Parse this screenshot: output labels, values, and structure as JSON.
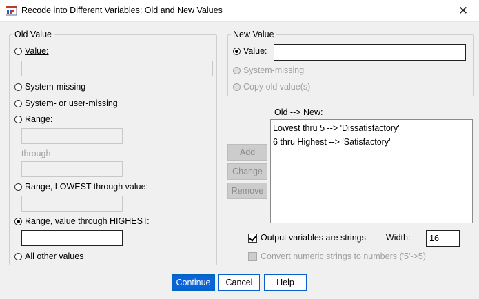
{
  "window": {
    "title": "Recode into Different Variables: Old and New Values",
    "close_glyph": "✕"
  },
  "old_value": {
    "legend": "Old Value",
    "value_label": "Value:",
    "system_missing_label": "System-missing",
    "system_or_user_missing_label": "System- or user-missing",
    "range_label": "Range:",
    "through_label": "through",
    "range_lowest_label": "Range, LOWEST through value:",
    "range_highest_label": "Range, value through HIGHEST:",
    "all_other_label": "All other values",
    "selected": "range_highest"
  },
  "new_value": {
    "legend": "New Value",
    "value_label": "Value:",
    "value_input": "",
    "system_missing_label": "System-missing",
    "copy_old_label": "Copy old value(s)",
    "selected": "value"
  },
  "mapping": {
    "label": "Old --> New:",
    "items": [
      "Lowest thru 5 --> 'Dissatisfactory'",
      "6 thru Highest --> 'Satisfactory'"
    ]
  },
  "actions": {
    "add": "Add",
    "change": "Change",
    "remove": "Remove"
  },
  "options": {
    "output_strings_label": "Output variables are strings",
    "output_strings_checked": true,
    "width_label": "Width:",
    "width_value": "16",
    "convert_label": "Convert numeric strings to numbers ('5'->5)",
    "convert_checked": false
  },
  "footer": {
    "continue": "Continue",
    "cancel": "Cancel",
    "help": "Help"
  },
  "colors": {
    "accent": "#0a64d6",
    "disabled_text": "#a0a0a0"
  }
}
